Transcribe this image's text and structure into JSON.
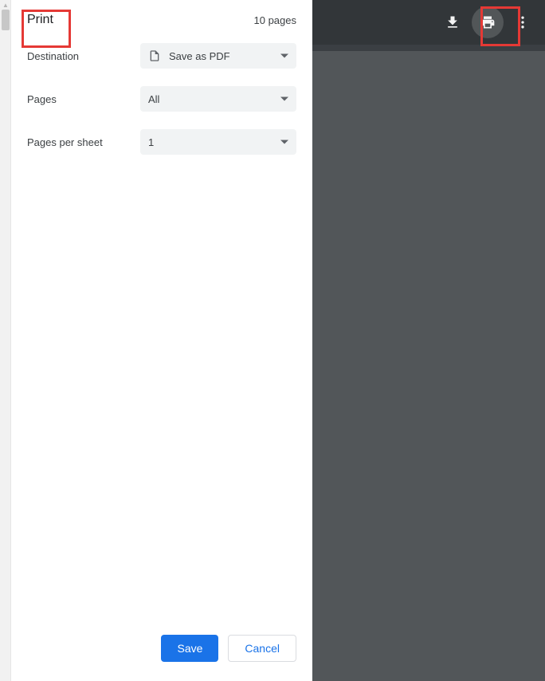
{
  "header": {
    "title": "Print",
    "page_count_label": "10 pages"
  },
  "rows": {
    "destination": {
      "label": "Destination",
      "value": "Save as PDF"
    },
    "pages": {
      "label": "Pages",
      "value": "All"
    },
    "pages_per_sheet": {
      "label": "Pages per sheet",
      "value": "1"
    }
  },
  "buttons": {
    "save": "Save",
    "cancel": "Cancel"
  },
  "icons": {
    "download": "download-icon",
    "print": "print-icon",
    "more": "more-icon",
    "file": "file-icon"
  }
}
